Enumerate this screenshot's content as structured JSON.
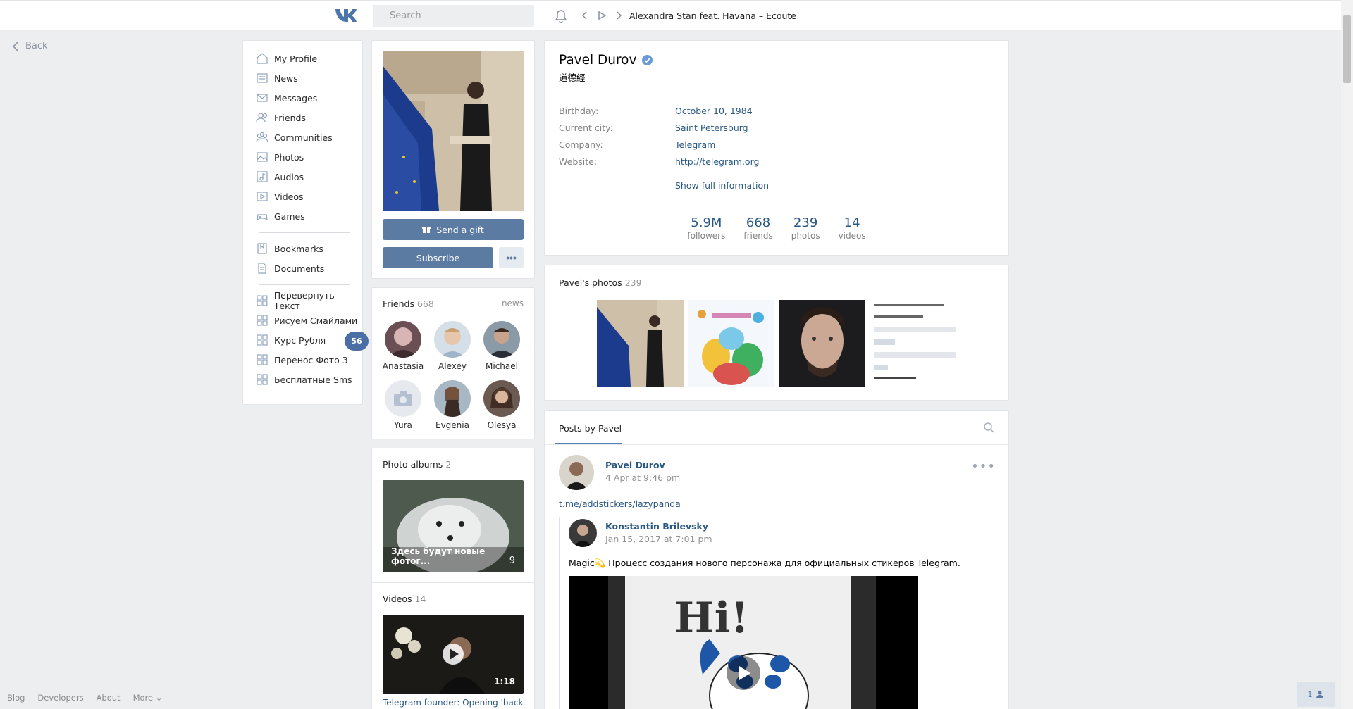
{
  "header": {
    "logo": "vk-logo",
    "search_placeholder": "Search",
    "now_playing": "Alexandra Stan feat. Havana – Ecoute"
  },
  "left": {
    "back_label": "Back",
    "footer": [
      "Blog",
      "Developers",
      "About",
      "More ⌄"
    ]
  },
  "nav": {
    "items": [
      {
        "label": "My Profile",
        "icon": "home-icon"
      },
      {
        "label": "News",
        "icon": "news-icon"
      },
      {
        "label": "Messages",
        "icon": "messages-icon"
      },
      {
        "label": "Friends",
        "icon": "friends-icon"
      },
      {
        "label": "Communities",
        "icon": "communities-icon"
      },
      {
        "label": "Photos",
        "icon": "photos-icon"
      },
      {
        "label": "Audios",
        "icon": "audios-icon"
      },
      {
        "label": "Videos",
        "icon": "videos-icon"
      },
      {
        "label": "Games",
        "icon": "games-icon"
      }
    ],
    "items2": [
      {
        "label": "Bookmarks",
        "icon": "bookmarks-icon"
      },
      {
        "label": "Documents",
        "icon": "documents-icon"
      }
    ],
    "apps": [
      {
        "label": "Перевернуть Текст"
      },
      {
        "label": "Рисуем Смайлами"
      },
      {
        "label": "Курс Рубля",
        "badge": "56"
      },
      {
        "label": "Перенос Фото 3"
      },
      {
        "label": "Бесплатные Sms"
      }
    ]
  },
  "profile_actions": {
    "gift_label": "Send a gift",
    "subscribe_label": "Subscribe",
    "more_label": "•••"
  },
  "friends": {
    "title": "Friends",
    "count": "668",
    "right_link": "news",
    "list": [
      "Anastasia",
      "Alexey",
      "Michael",
      "Yura",
      "Evgenia",
      "Olesya"
    ]
  },
  "albums": {
    "title": "Photo albums",
    "count": "2",
    "caption": "Здесь будут новые фотог...",
    "photo_count": "9"
  },
  "videos": {
    "title": "Videos",
    "count": "14",
    "duration": "1:18",
    "video_title": "Telegram founder: Opening 'back"
  },
  "profile": {
    "name": "Pavel Durov",
    "status": "道德經",
    "info": [
      {
        "label": "Birthday:",
        "value": "October 10, 1984"
      },
      {
        "label": "Current city:",
        "value": "Saint Petersburg"
      },
      {
        "label": "Company:",
        "value": "Telegram"
      },
      {
        "label": "Website:",
        "value": "http://telegram.org"
      }
    ],
    "show_full": "Show full information",
    "stats": [
      {
        "value": "5.9M",
        "label": "followers"
      },
      {
        "value": "668",
        "label": "friends"
      },
      {
        "value": "239",
        "label": "photos"
      },
      {
        "value": "14",
        "label": "videos"
      }
    ]
  },
  "photos": {
    "title": "Pavel's photos",
    "count": "239"
  },
  "posts": {
    "tab_label": "Posts by Pavel",
    "author": "Pavel Durov",
    "date": "4 Apr at 9:46 pm",
    "link": "t.me/addstickers/lazypanda",
    "repost_author": "Konstantin Brilevsky",
    "repost_date": "Jan 15, 2017 at 7:01 pm",
    "repost_text": "Magic💫 Процесс создания нового персонажа для официальных стикеров Telegram.",
    "video_text": "Hi!"
  },
  "chat": {
    "count": "1"
  },
  "colors": {
    "accent": "#5181b8",
    "button": "#5b7ba3",
    "link": "#2a5885",
    "background": "#edeef0"
  }
}
